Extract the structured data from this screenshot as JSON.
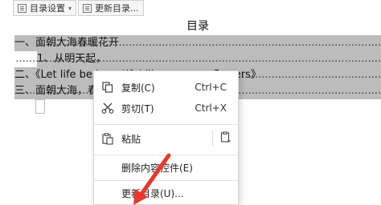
{
  "toolbar": {
    "toc_settings_label": "目录设置",
    "update_toc_label": "更新目录..."
  },
  "toc": {
    "title": "目录",
    "lines": [
      {
        "text": "一、面朝大海春暖花开",
        "dots": "........................................................................................................"
      },
      {
        "text": "1、从明天起，",
        "dots": "..............................................................................................................."
      },
      {
        "text": "二、《Let life be beautiful like summer flowers》",
        "dots": "............................................................"
      },
      {
        "text": "三、面朝大海，春",
        "dots": "......................................................................................................................"
      }
    ]
  },
  "context_menu": {
    "copy": {
      "label": "复制(C)",
      "shortcut": "Ctrl+C"
    },
    "cut": {
      "label": "剪切(T)",
      "shortcut": "Ctrl+X"
    },
    "paste": {
      "label": "粘贴"
    },
    "delete_control": {
      "label": "删除内容控件(E)"
    },
    "update_toc": {
      "label": "更新目录(U)..."
    }
  },
  "colors": {
    "selection": "#bcbcbc",
    "arrow": "#e8372c"
  }
}
